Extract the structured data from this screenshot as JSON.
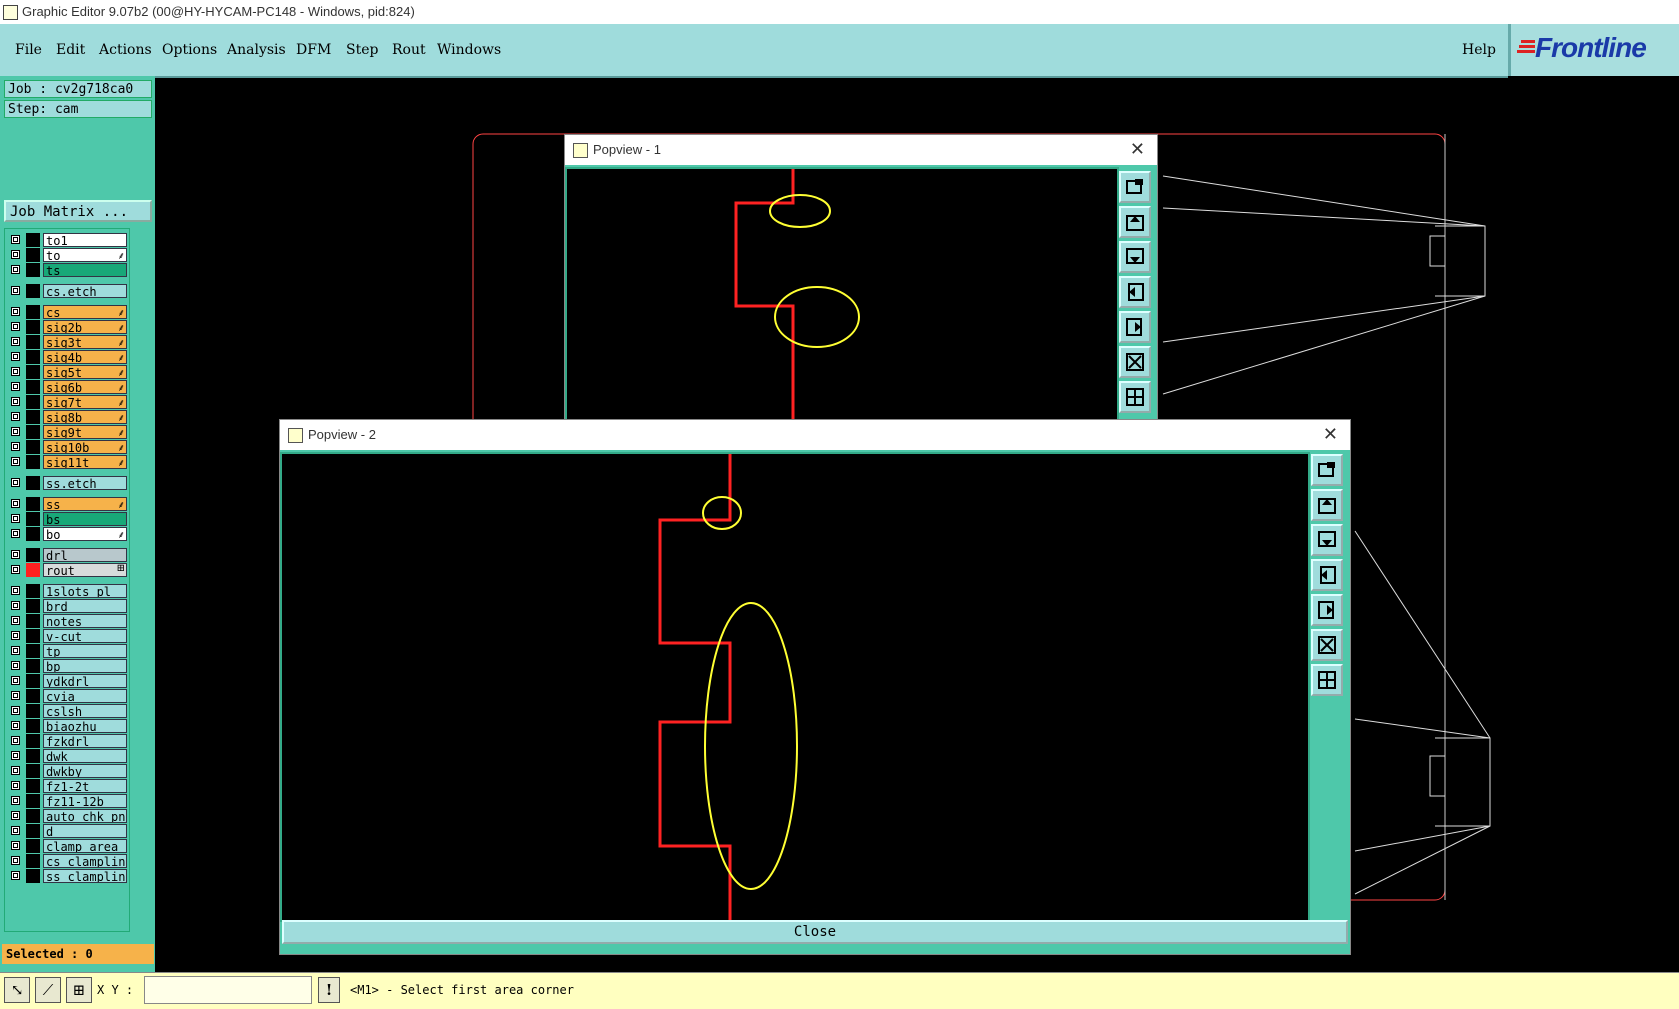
{
  "window": {
    "title": "Graphic Editor 9.07b2 (00@HY-HYCAM-PC148 - Windows, pid:824)"
  },
  "menu": {
    "items": [
      "File",
      "Edit",
      "Actions",
      "Options",
      "Analysis",
      "DFM",
      "Step",
      "Rout",
      "Windows"
    ],
    "help": "Help",
    "logo": "Frontline"
  },
  "job": {
    "label": "Job : cv2g718ca0",
    "step": "Step: cam",
    "matrix_button": "Job Matrix ..."
  },
  "layers": [
    {
      "name": "to1",
      "bg": "#ffffff",
      "mark": ""
    },
    {
      "name": "to",
      "bg": "#ffffff",
      "mark": "⸙"
    },
    {
      "name": "ts",
      "bg": "#18a878",
      "mark": ""
    },
    {
      "name": "cs.etch",
      "bg": "#9fdcdc",
      "mark": ""
    },
    {
      "name": "cs",
      "bg": "#f6b24a",
      "mark": "⸙"
    },
    {
      "name": "sig2b",
      "bg": "#f6b24a",
      "mark": "⸙"
    },
    {
      "name": "sig3t",
      "bg": "#f6b24a",
      "mark": "⸙"
    },
    {
      "name": "sig4b",
      "bg": "#f6b24a",
      "mark": "⸙"
    },
    {
      "name": "sig5t",
      "bg": "#f6b24a",
      "mark": "⸙"
    },
    {
      "name": "sig6b",
      "bg": "#f6b24a",
      "mark": "⸙"
    },
    {
      "name": "sig7t",
      "bg": "#f6b24a",
      "mark": "⸙"
    },
    {
      "name": "sig8b",
      "bg": "#f6b24a",
      "mark": "⸙"
    },
    {
      "name": "sig9t",
      "bg": "#f6b24a",
      "mark": "⸙"
    },
    {
      "name": "sig10b",
      "bg": "#f6b24a",
      "mark": "⸙"
    },
    {
      "name": "sig11t",
      "bg": "#f6b24a",
      "mark": "⸙"
    },
    {
      "name": "ss.etch",
      "bg": "#9fdcdc",
      "mark": ""
    },
    {
      "name": "ss",
      "bg": "#f6b24a",
      "mark": "⸙"
    },
    {
      "name": "bs",
      "bg": "#18a878",
      "mark": ""
    },
    {
      "name": "bo",
      "bg": "#ffffff",
      "mark": "⸙"
    },
    {
      "name": "drl",
      "bg": "#b8c8cc",
      "mark": ""
    },
    {
      "name": "rout",
      "bg": "#d8dcdc",
      "mark": "⊞"
    },
    {
      "name": "1slots_pl",
      "bg": "#9fdcdc",
      "mark": ""
    },
    {
      "name": "brd",
      "bg": "#9fdcdc",
      "mark": ""
    },
    {
      "name": "notes",
      "bg": "#9fdcdc",
      "mark": ""
    },
    {
      "name": "v-cut",
      "bg": "#9fdcdc",
      "mark": ""
    },
    {
      "name": "tp",
      "bg": "#9fdcdc",
      "mark": ""
    },
    {
      "name": "bp",
      "bg": "#9fdcdc",
      "mark": ""
    },
    {
      "name": "ydkdrl",
      "bg": "#9fdcdc",
      "mark": ""
    },
    {
      "name": "cvia",
      "bg": "#9fdcdc",
      "mark": ""
    },
    {
      "name": "cslsh",
      "bg": "#9fdcdc",
      "mark": ""
    },
    {
      "name": "biaozhu",
      "bg": "#9fdcdc",
      "mark": ""
    },
    {
      "name": "fzkdrl",
      "bg": "#9fdcdc",
      "mark": ""
    },
    {
      "name": "dwk",
      "bg": "#9fdcdc",
      "mark": ""
    },
    {
      "name": "dwkby",
      "bg": "#9fdcdc",
      "mark": ""
    },
    {
      "name": "fz1-2t",
      "bg": "#9fdcdc",
      "mark": ""
    },
    {
      "name": "fz11-12b",
      "bg": "#9fdcdc",
      "mark": ""
    },
    {
      "name": "auto_chk_pnl",
      "bg": "#9fdcdc",
      "mark": ""
    },
    {
      "name": "d",
      "bg": "#9fdcdc",
      "mark": ""
    },
    {
      "name": "clamp_area",
      "bg": "#9fdcdc",
      "mark": ""
    },
    {
      "name": "cs_clampline",
      "bg": "#9fdcdc",
      "mark": ""
    },
    {
      "name": "ss_clampline",
      "bg": "#9fdcdc",
      "mark": ""
    }
  ],
  "selected": "Selected : 0",
  "popup1": {
    "title": "Popview - 1"
  },
  "popup2": {
    "title": "Popview - 2",
    "close_button": "Close"
  },
  "status": {
    "xy_label": "X Y :",
    "xy_value": "",
    "prompt": "<M1> - Select first area corner"
  },
  "colors": {
    "trace": "#ff2222",
    "highlight": "#ffff33",
    "teal": "#4ec8aa",
    "panel": "#9fdcdc"
  }
}
